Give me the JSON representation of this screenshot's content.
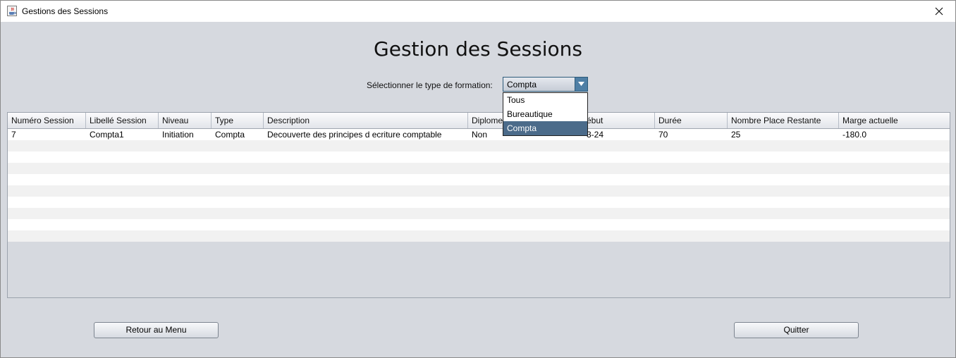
{
  "window": {
    "title": "Gestions des Sessions"
  },
  "page": {
    "heading": "Gestion des Sessions"
  },
  "filter": {
    "label": "Sélectionner le type de formation:",
    "selected": "Compta",
    "options": [
      "Tous",
      "Bureautique",
      "Compta"
    ]
  },
  "table": {
    "columns": [
      "Numéro Session",
      "Libellé Session",
      "Niveau",
      "Type",
      "Description",
      "Diplome",
      "Date Début",
      "Durée",
      "Nombre Place Restante",
      "Marge actuelle"
    ],
    "visible_headers": [
      "Numéro Session",
      "Libellé Session",
      "Niveau",
      "Type",
      "Description",
      "Diplome",
      "ébut",
      "Durée",
      "Nombre Place Restante",
      "Marge actuelle"
    ],
    "rows": [
      [
        "7",
        "Compta1",
        "Initiation",
        "Compta",
        "Decouverte des principes d ecriture comptable",
        "Non",
        "3-24",
        "70",
        "25",
        "-180.0"
      ]
    ]
  },
  "buttons": {
    "back": "Retour au Menu",
    "quit": "Quitter"
  },
  "icons": {
    "app": "java-cup-icon",
    "close": "close-icon",
    "combo_arrow": "triangle-down-icon"
  }
}
